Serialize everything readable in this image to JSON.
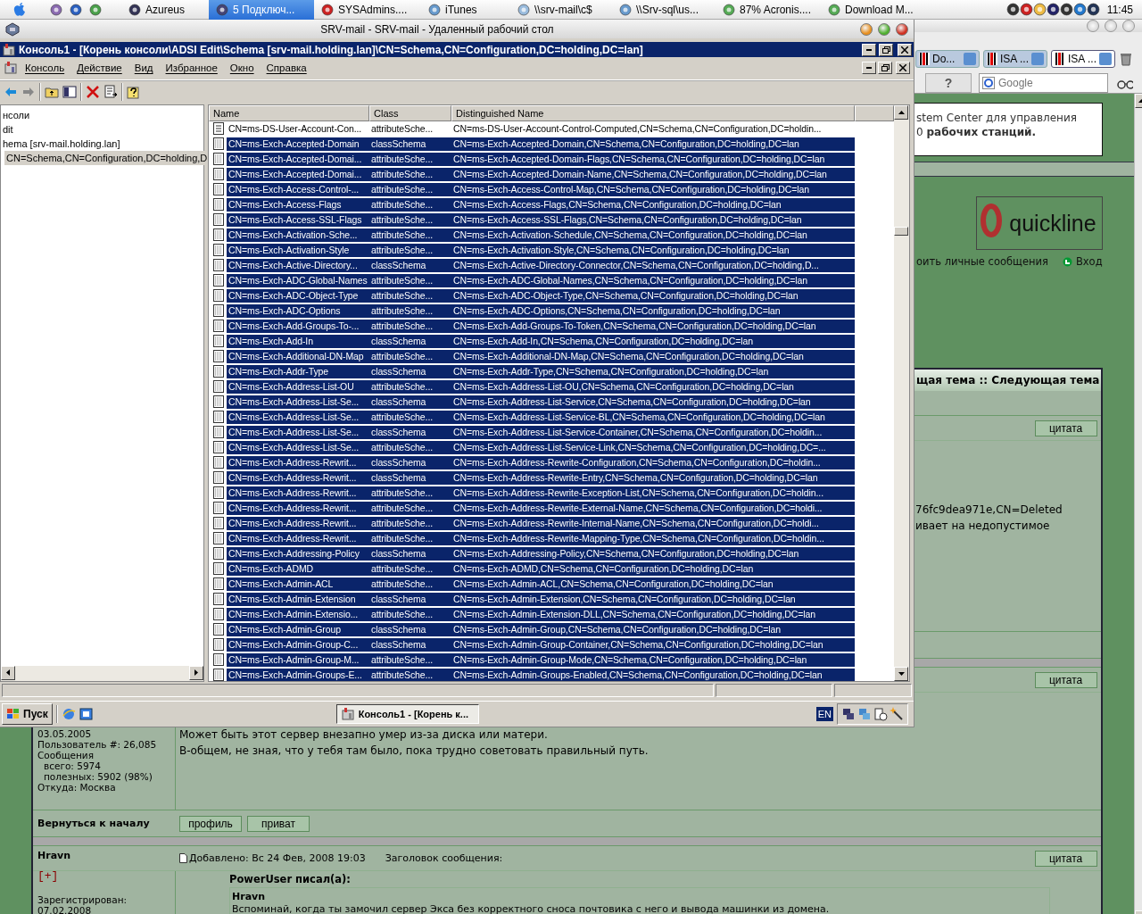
{
  "menubar": {
    "items": [
      {
        "label": "Azureus",
        "selected": false
      },
      {
        "label": "5 Подключ...",
        "selected": true
      },
      {
        "label": "SYSAdmins....",
        "selected": false
      },
      {
        "label": "iTunes",
        "selected": false
      },
      {
        "label": "\\\\srv-mail\\c$",
        "selected": false
      },
      {
        "label": "\\\\Srv-sql\\us...",
        "selected": false
      },
      {
        "label": "87% Acronis....",
        "selected": false
      },
      {
        "label": "Download M...",
        "selected": false
      }
    ],
    "clock": "11:45"
  },
  "browser": {
    "tabs": [
      {
        "label": "Do...",
        "selected": false
      },
      {
        "label": "ISA ...",
        "selected": false
      },
      {
        "label": "ISA ...",
        "selected": true
      }
    ],
    "help_button": "?",
    "search": {
      "placeholder": "Google"
    },
    "banner": [
      "stem Center для управления",
      "0 **рабочих станций.**"
    ],
    "logo": "quickline",
    "nav": [
      "оить личные сообщения",
      "Вход"
    ],
    "topic_nav": "щая тема :: Следующая тема",
    "posts": [
      {
        "quote_button": "цитата",
        "body": [
          "76fc9dea971e,CN=Deleted",
          "ивает на недопустимое"
        ]
      },
      {
        "quote_button": "цитата",
        "author_info": [
          "03.05.2005",
          "Пользователь #: 26,085",
          "Сообщения",
          "всего: 5974",
          "полезных: 5902 (98%)",
          "Откуда: Москва"
        ],
        "body": [
          "Может быть этот сервер внезапно умер из-за диска или матери.",
          "В-общем, не зная, что у тебя там было, пока трудно советовать правильный путь."
        ],
        "back_to_top": "Вернуться к началу",
        "buttons": [
          "профиль",
          "приват"
        ]
      },
      {
        "quote_button": "цитата",
        "author": "Hravn",
        "rank": "[+]",
        "author_info": [
          "Зарегистрирован:",
          "07.02.2008"
        ],
        "posted": "Добавлено: Вс 24 Фев, 2008 19:03",
        "subject_label": "Заголовок сообщения:",
        "quote_title": "PowerUser писал(а):",
        "quote_author": "Hravn",
        "quote_text": "Вспоминай, когда ты замочил сервер Экса без корректного сноса почтовика с него и вывода машинки из домена."
      }
    ]
  },
  "rdp": {
    "title": "SRV-mail - SRV-mail - Удаленный рабочий стол",
    "mmc_title": "Консоль1 - [Корень консоли\\ADSI Edit\\Schema [srv-mail.holding.lan]\\CN=Schema,CN=Configuration,DC=holding,DC=lan]",
    "menu": [
      "Консоль",
      "Действие",
      "Вид",
      "Избранное",
      "Окно",
      "Справка"
    ],
    "tree": [
      {
        "label": "нсоли",
        "selected": false
      },
      {
        "label": "dit",
        "selected": false
      },
      {
        "label": "hema [srv-mail.holding.lan]",
        "selected": false
      },
      {
        "label": "CN=Schema,CN=Configuration,DC=holding,D",
        "selected": true
      }
    ],
    "columns": [
      "Name",
      "Class",
      "Distinguished Name"
    ],
    "rows": [
      {
        "name": "CN=ms-DS-User-Account-Con...",
        "class": "attributeSche...",
        "dn": "CN=ms-DS-User-Account-Control-Computed,CN=Schema,CN=Configuration,DC=holdin...",
        "selected": false
      },
      {
        "name": "CN=ms-Exch-Accepted-Domain",
        "class": "classSchema",
        "dn": "CN=ms-Exch-Accepted-Domain,CN=Schema,CN=Configuration,DC=holding,DC=lan",
        "selected": true
      },
      {
        "name": "CN=ms-Exch-Accepted-Domai...",
        "class": "attributeSche...",
        "dn": "CN=ms-Exch-Accepted-Domain-Flags,CN=Schema,CN=Configuration,DC=holding,DC=lan",
        "selected": true
      },
      {
        "name": "CN=ms-Exch-Accepted-Domai...",
        "class": "attributeSche...",
        "dn": "CN=ms-Exch-Accepted-Domain-Name,CN=Schema,CN=Configuration,DC=holding,DC=lan",
        "selected": true
      },
      {
        "name": "CN=ms-Exch-Access-Control-...",
        "class": "attributeSche...",
        "dn": "CN=ms-Exch-Access-Control-Map,CN=Schema,CN=Configuration,DC=holding,DC=lan",
        "selected": true
      },
      {
        "name": "CN=ms-Exch-Access-Flags",
        "class": "attributeSche...",
        "dn": "CN=ms-Exch-Access-Flags,CN=Schema,CN=Configuration,DC=holding,DC=lan",
        "selected": true
      },
      {
        "name": "CN=ms-Exch-Access-SSL-Flags",
        "class": "attributeSche...",
        "dn": "CN=ms-Exch-Access-SSL-Flags,CN=Schema,CN=Configuration,DC=holding,DC=lan",
        "selected": true
      },
      {
        "name": "CN=ms-Exch-Activation-Sche...",
        "class": "attributeSche...",
        "dn": "CN=ms-Exch-Activation-Schedule,CN=Schema,CN=Configuration,DC=holding,DC=lan",
        "selected": true
      },
      {
        "name": "CN=ms-Exch-Activation-Style",
        "class": "attributeSche...",
        "dn": "CN=ms-Exch-Activation-Style,CN=Schema,CN=Configuration,DC=holding,DC=lan",
        "selected": true
      },
      {
        "name": "CN=ms-Exch-Active-Directory...",
        "class": "classSchema",
        "dn": "CN=ms-Exch-Active-Directory-Connector,CN=Schema,CN=Configuration,DC=holding,D...",
        "selected": true
      },
      {
        "name": "CN=ms-Exch-ADC-Global-Names",
        "class": "attributeSche...",
        "dn": "CN=ms-Exch-ADC-Global-Names,CN=Schema,CN=Configuration,DC=holding,DC=lan",
        "selected": true
      },
      {
        "name": "CN=ms-Exch-ADC-Object-Type",
        "class": "attributeSche...",
        "dn": "CN=ms-Exch-ADC-Object-Type,CN=Schema,CN=Configuration,DC=holding,DC=lan",
        "selected": true
      },
      {
        "name": "CN=ms-Exch-ADC-Options",
        "class": "attributeSche...",
        "dn": "CN=ms-Exch-ADC-Options,CN=Schema,CN=Configuration,DC=holding,DC=lan",
        "selected": true
      },
      {
        "name": "CN=ms-Exch-Add-Groups-To-...",
        "class": "attributeSche...",
        "dn": "CN=ms-Exch-Add-Groups-To-Token,CN=Schema,CN=Configuration,DC=holding,DC=lan",
        "selected": true
      },
      {
        "name": "CN=ms-Exch-Add-In",
        "class": "classSchema",
        "dn": "CN=ms-Exch-Add-In,CN=Schema,CN=Configuration,DC=holding,DC=lan",
        "selected": true
      },
      {
        "name": "CN=ms-Exch-Additional-DN-Map",
        "class": "attributeSche...",
        "dn": "CN=ms-Exch-Additional-DN-Map,CN=Schema,CN=Configuration,DC=holding,DC=lan",
        "selected": true
      },
      {
        "name": "CN=ms-Exch-Addr-Type",
        "class": "classSchema",
        "dn": "CN=ms-Exch-Addr-Type,CN=Schema,CN=Configuration,DC=holding,DC=lan",
        "selected": true
      },
      {
        "name": "CN=ms-Exch-Address-List-OU",
        "class": "attributeSche...",
        "dn": "CN=ms-Exch-Address-List-OU,CN=Schema,CN=Configuration,DC=holding,DC=lan",
        "selected": true
      },
      {
        "name": "CN=ms-Exch-Address-List-Se...",
        "class": "classSchema",
        "dn": "CN=ms-Exch-Address-List-Service,CN=Schema,CN=Configuration,DC=holding,DC=lan",
        "selected": true
      },
      {
        "name": "CN=ms-Exch-Address-List-Se...",
        "class": "attributeSche...",
        "dn": "CN=ms-Exch-Address-List-Service-BL,CN=Schema,CN=Configuration,DC=holding,DC=lan",
        "selected": true
      },
      {
        "name": "CN=ms-Exch-Address-List-Se...",
        "class": "classSchema",
        "dn": "CN=ms-Exch-Address-List-Service-Container,CN=Schema,CN=Configuration,DC=holdin...",
        "selected": true
      },
      {
        "name": "CN=ms-Exch-Address-List-Se...",
        "class": "attributeSche...",
        "dn": "CN=ms-Exch-Address-List-Service-Link,CN=Schema,CN=Configuration,DC=holding,DC=...",
        "selected": true
      },
      {
        "name": "CN=ms-Exch-Address-Rewrit...",
        "class": "classSchema",
        "dn": "CN=ms-Exch-Address-Rewrite-Configuration,CN=Schema,CN=Configuration,DC=holdin...",
        "selected": true
      },
      {
        "name": "CN=ms-Exch-Address-Rewrit...",
        "class": "classSchema",
        "dn": "CN=ms-Exch-Address-Rewrite-Entry,CN=Schema,CN=Configuration,DC=holding,DC=lan",
        "selected": true
      },
      {
        "name": "CN=ms-Exch-Address-Rewrit...",
        "class": "attributeSche...",
        "dn": "CN=ms-Exch-Address-Rewrite-Exception-List,CN=Schema,CN=Configuration,DC=holdin...",
        "selected": true
      },
      {
        "name": "CN=ms-Exch-Address-Rewrit...",
        "class": "attributeSche...",
        "dn": "CN=ms-Exch-Address-Rewrite-External-Name,CN=Schema,CN=Configuration,DC=holdi...",
        "selected": true
      },
      {
        "name": "CN=ms-Exch-Address-Rewrit...",
        "class": "attributeSche...",
        "dn": "CN=ms-Exch-Address-Rewrite-Internal-Name,CN=Schema,CN=Configuration,DC=holdi...",
        "selected": true
      },
      {
        "name": "CN=ms-Exch-Address-Rewrit...",
        "class": "attributeSche...",
        "dn": "CN=ms-Exch-Address-Rewrite-Mapping-Type,CN=Schema,CN=Configuration,DC=holdin...",
        "selected": true
      },
      {
        "name": "CN=ms-Exch-Addressing-Policy",
        "class": "classSchema",
        "dn": "CN=ms-Exch-Addressing-Policy,CN=Schema,CN=Configuration,DC=holding,DC=lan",
        "selected": true
      },
      {
        "name": "CN=ms-Exch-ADMD",
        "class": "attributeSche...",
        "dn": "CN=ms-Exch-ADMD,CN=Schema,CN=Configuration,DC=holding,DC=lan",
        "selected": true
      },
      {
        "name": "CN=ms-Exch-Admin-ACL",
        "class": "attributeSche...",
        "dn": "CN=ms-Exch-Admin-ACL,CN=Schema,CN=Configuration,DC=holding,DC=lan",
        "selected": true
      },
      {
        "name": "CN=ms-Exch-Admin-Extension",
        "class": "classSchema",
        "dn": "CN=ms-Exch-Admin-Extension,CN=Schema,CN=Configuration,DC=holding,DC=lan",
        "selected": true
      },
      {
        "name": "CN=ms-Exch-Admin-Extensio...",
        "class": "attributeSche...",
        "dn": "CN=ms-Exch-Admin-Extension-DLL,CN=Schema,CN=Configuration,DC=holding,DC=lan",
        "selected": true
      },
      {
        "name": "CN=ms-Exch-Admin-Group",
        "class": "classSchema",
        "dn": "CN=ms-Exch-Admin-Group,CN=Schema,CN=Configuration,DC=holding,DC=lan",
        "selected": true
      },
      {
        "name": "CN=ms-Exch-Admin-Group-C...",
        "class": "classSchema",
        "dn": "CN=ms-Exch-Admin-Group-Container,CN=Schema,CN=Configuration,DC=holding,DC=lan",
        "selected": true
      },
      {
        "name": "CN=ms-Exch-Admin-Group-M...",
        "class": "attributeSche...",
        "dn": "CN=ms-Exch-Admin-Group-Mode,CN=Schema,CN=Configuration,DC=holding,DC=lan",
        "selected": true
      },
      {
        "name": "CN=ms-Exch-Admin-Groups-E...",
        "class": "attributeSche...",
        "dn": "CN=ms-Exch-Admin-Groups-Enabled,CN=Schema,CN=Configuration,DC=holding,DC=lan",
        "selected": true
      }
    ],
    "taskbar": {
      "start": "Пуск",
      "task": "Консоль1 - [Корень к...",
      "language": "EN"
    }
  }
}
